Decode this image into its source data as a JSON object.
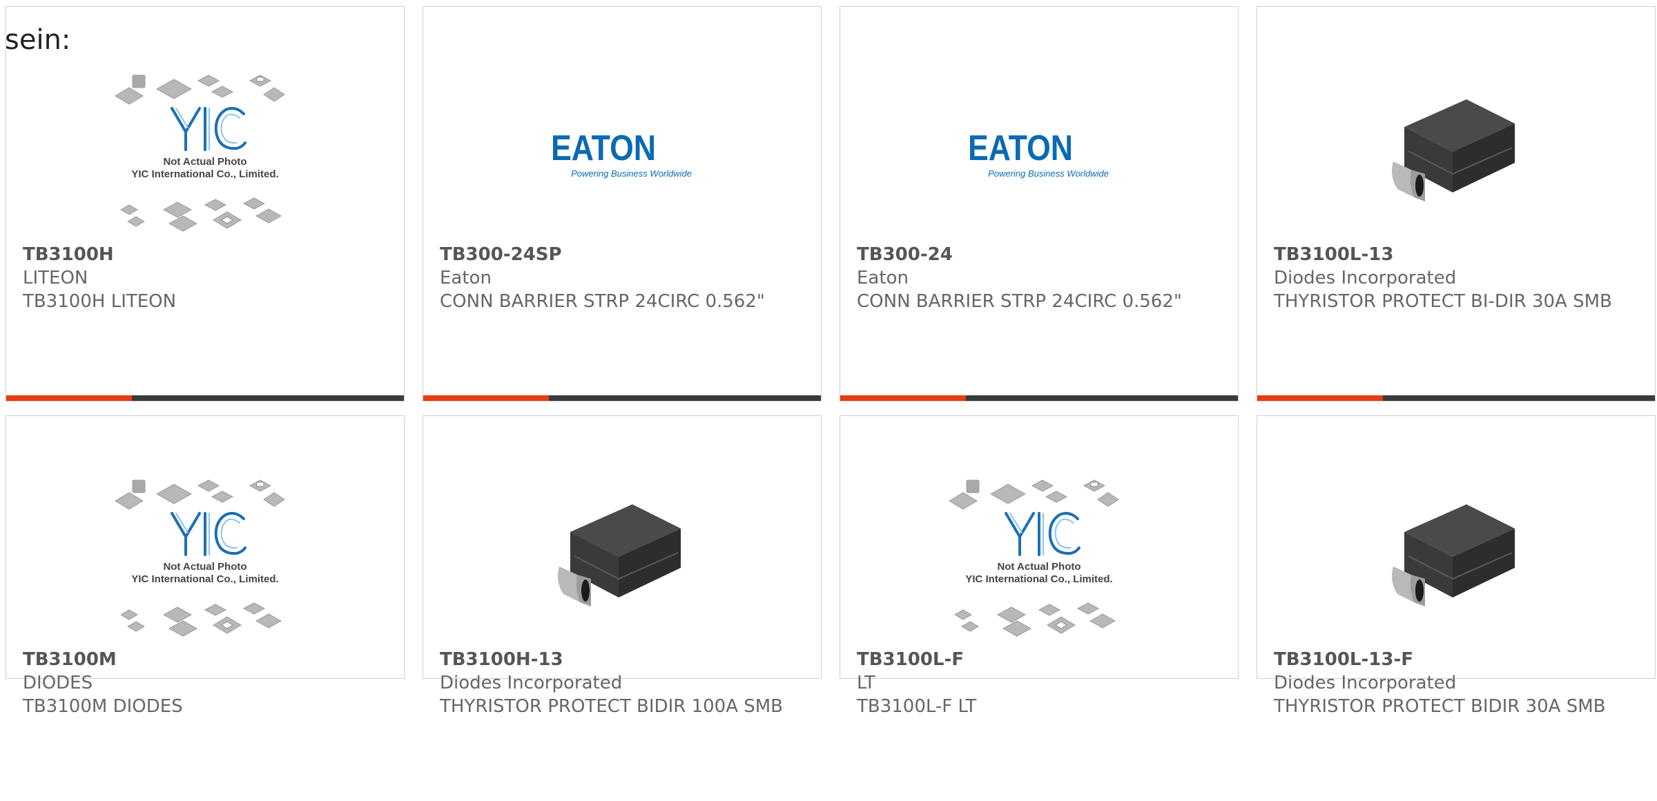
{
  "intro": "sein:",
  "logos": {
    "yic": {
      "brand": "YIC",
      "line1": "Not Actual Photo",
      "line2": "YIC International Co., Limited."
    },
    "eaton": {
      "brand": "EATON",
      "tagline": "Powering Business Worldwide"
    }
  },
  "products": [
    {
      "part": "TB3100H",
      "manufacturer": "LITEON",
      "description": "TB3100H LITEON",
      "image": "yic-placeholder"
    },
    {
      "part": "TB300-24SP",
      "manufacturer": "Eaton",
      "description": "CONN BARRIER STRP 24CIRC 0.562\"",
      "image": "eaton-logo"
    },
    {
      "part": "TB300-24",
      "manufacturer": "Eaton",
      "description": "CONN BARRIER STRP 24CIRC 0.562\"",
      "image": "eaton-logo"
    },
    {
      "part": "TB3100L-13",
      "manufacturer": "Diodes Incorporated",
      "description": "THYRISTOR PROTECT BI-DIR 30A SMB",
      "image": "smb-package"
    },
    {
      "part": "TB3100M",
      "manufacturer": "DIODES",
      "description": "TB3100M DIODES",
      "image": "yic-placeholder"
    },
    {
      "part": "TB3100H-13",
      "manufacturer": "Diodes Incorporated",
      "description": "THYRISTOR PROTECT BIDIR 100A SMB",
      "image": "smb-package"
    },
    {
      "part": "TB3100L-F",
      "manufacturer": "LT",
      "description": "TB3100L-F LT",
      "image": "yic-placeholder"
    },
    {
      "part": "TB3100L-13-F",
      "manufacturer": "Diodes Incorporated",
      "description": "THYRISTOR PROTECT BIDIR 30A SMB",
      "image": "smb-package"
    }
  ],
  "colors": {
    "accent": "#e63c12",
    "bar": "#3a3a3a",
    "eaton_blue": "#0a6ab3",
    "yic_blue": "#1b6fb5"
  }
}
